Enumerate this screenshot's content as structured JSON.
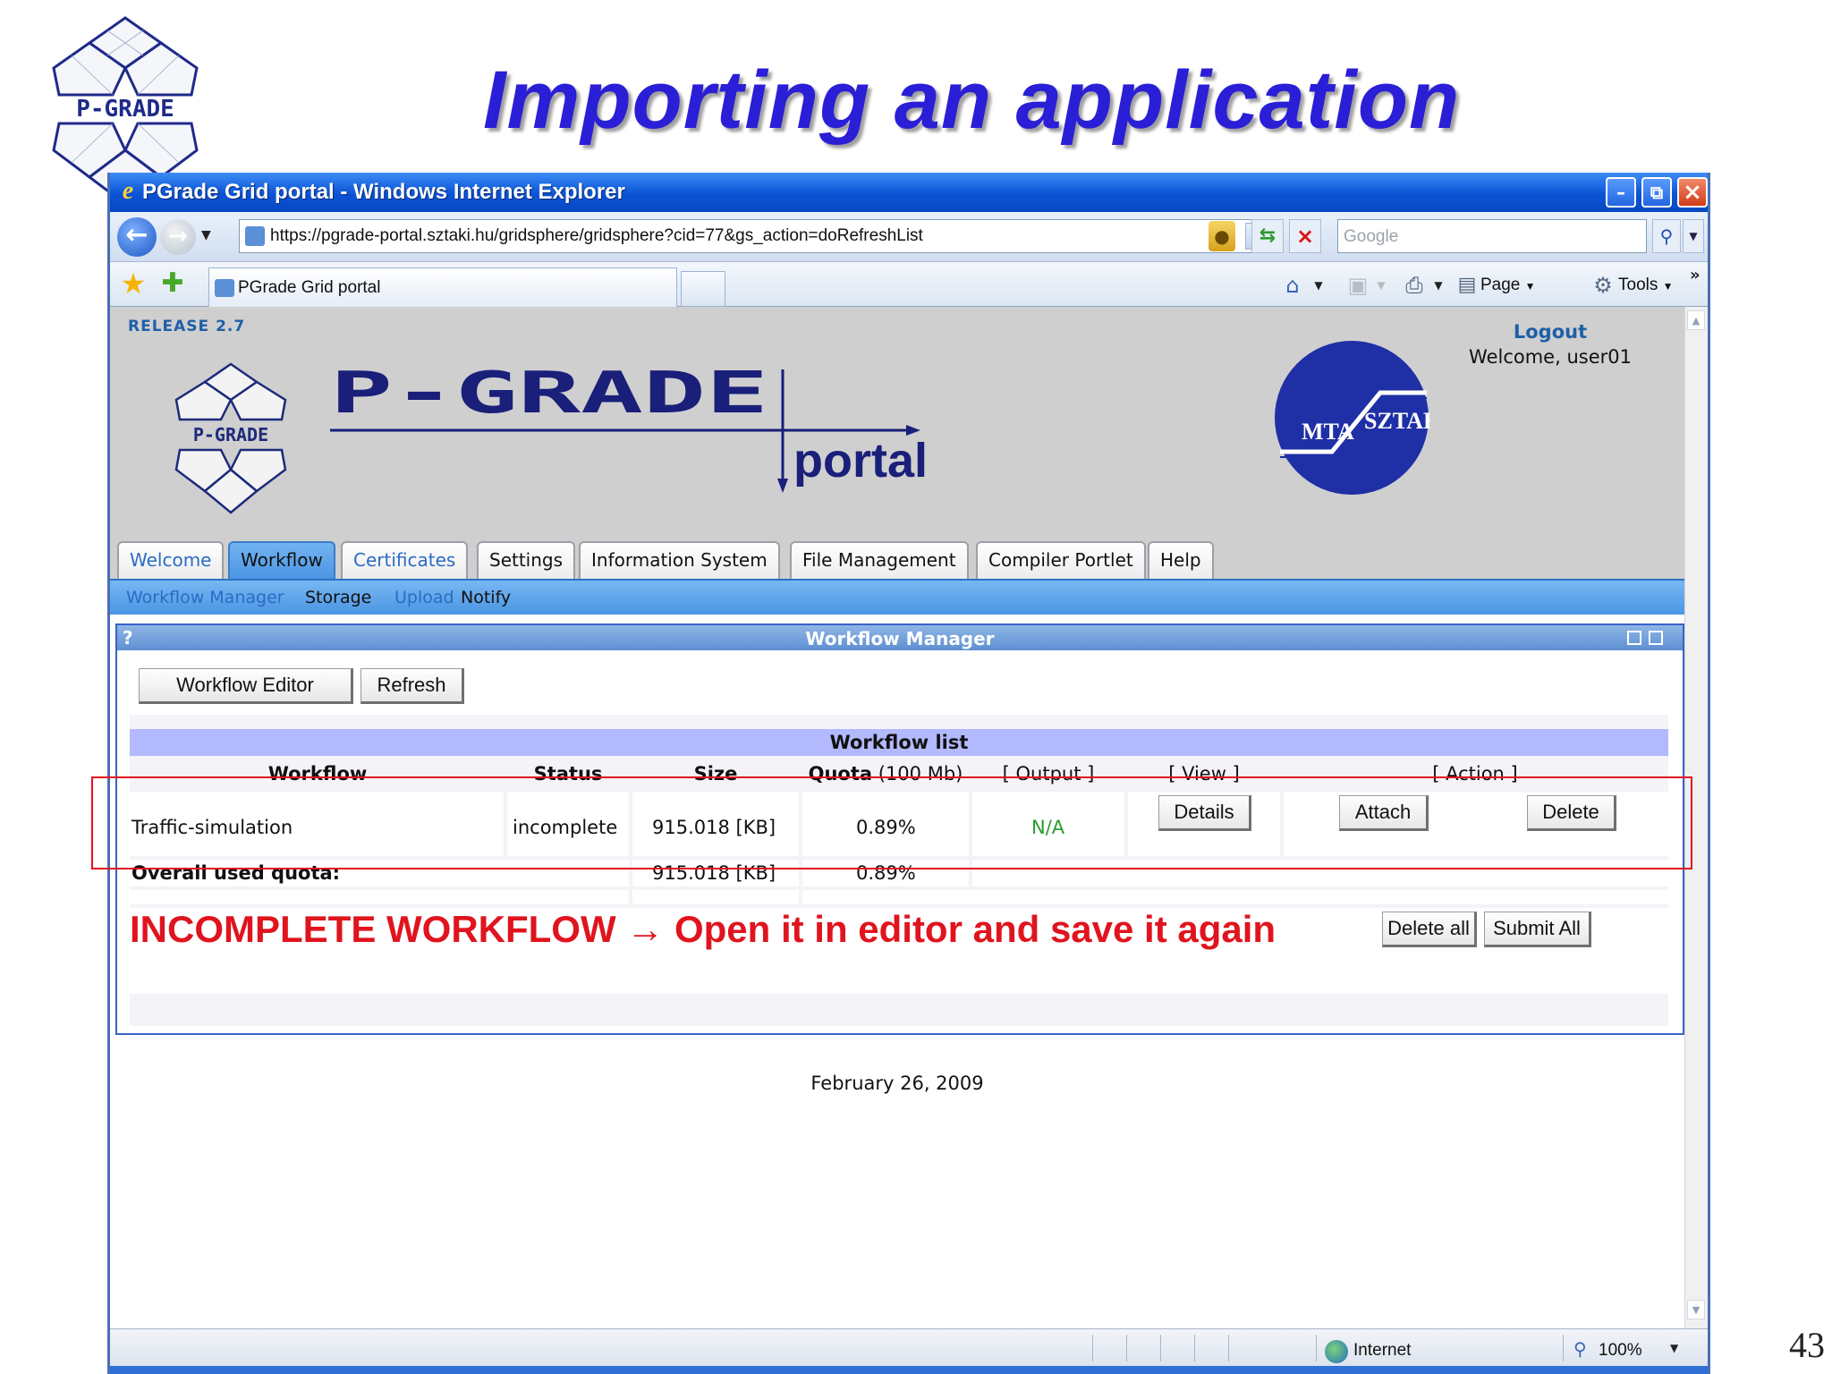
{
  "slide": {
    "title": "Importing an application",
    "page_number": "43",
    "logo_text": "P-GRADE"
  },
  "browser": {
    "window_title": "PGrade Grid portal - Windows Internet Explorer",
    "address_url": "https://pgrade-portal.sztaki.hu/gridsphere/gridsphere?cid=77&gs_action=doRefreshList",
    "search_placeholder": "Google",
    "tab_label": "PGrade Grid portal",
    "command_bar": {
      "page_label": "Page",
      "tools_label": "Tools"
    },
    "status": {
      "zone_label": "Internet",
      "zoom_label": "100%"
    }
  },
  "portal": {
    "release_label": "RELEASE 2.7",
    "logout_label": "Logout",
    "welcome_text": "Welcome, user01",
    "logo_wordmark": "P-GRADE",
    "logo_subtext": "portal",
    "sztaki_left": "MTA",
    "sztaki_right": "SZTAKI",
    "tabs": [
      {
        "label": "Welcome"
      },
      {
        "label": "Workflow"
      },
      {
        "label": "Certificates"
      },
      {
        "label": "Settings"
      },
      {
        "label": "Information System"
      },
      {
        "label": "File Management"
      },
      {
        "label": "Compiler Portlet"
      },
      {
        "label": "Help"
      }
    ],
    "active_tab": "Workflow",
    "subnav": [
      {
        "label": "Workflow Manager"
      },
      {
        "label": "Storage"
      },
      {
        "label": "Upload"
      },
      {
        "label": "Notify"
      }
    ],
    "footer_date": "February 26, 2009"
  },
  "workflow_manager": {
    "panel_title": "Workflow Manager",
    "help_label": "?",
    "buttons": {
      "editor": "Workflow Editor",
      "refresh": "Refresh",
      "delete_all": "Delete all",
      "submit_all": "Submit All"
    },
    "list_title": "Workflow list",
    "columns": {
      "workflow": "Workflow",
      "status": "Status",
      "size": "Size",
      "quota_bold": "Quota",
      "quota_rest": " (100 Mb)",
      "output": "[ Output ]",
      "view": "[ View ]",
      "action": "[ Action ]"
    },
    "rows": [
      {
        "name": "Traffic-simulation",
        "status": "incomplete",
        "size": "915.018 [KB]",
        "quota": "0.89%",
        "output": "N/A",
        "view_button": "Details",
        "attach_button": "Attach",
        "delete_button": "Delete"
      }
    ],
    "overall": {
      "label": "Overall used quota:",
      "size": "915.018 [KB]",
      "quota": "0.89%"
    },
    "annotation": "INCOMPLETE WORKFLOW → Open it in editor and save it again"
  },
  "colors": {
    "title_blue": "#2a1fd6",
    "annotation_red": "#e0141e",
    "portal_link": "#2a6cc4",
    "na_green": "#2e9a2e",
    "panel_border": "#3a62c6"
  }
}
